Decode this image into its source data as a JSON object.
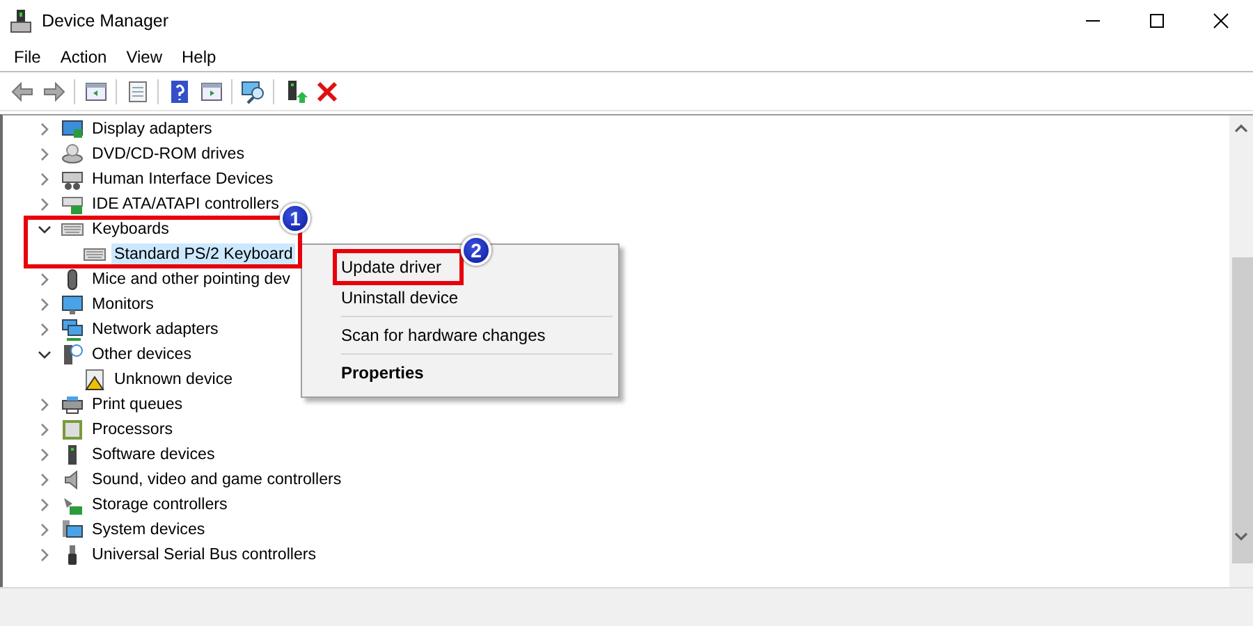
{
  "window": {
    "title": "Device Manager"
  },
  "menu": [
    "File",
    "Action",
    "View",
    "Help"
  ],
  "tree": [
    {
      "label": "Display adapters",
      "expanded": false
    },
    {
      "label": "DVD/CD-ROM drives",
      "expanded": false
    },
    {
      "label": "Human Interface Devices",
      "expanded": false
    },
    {
      "label": "IDE ATA/ATAPI controllers",
      "expanded": false
    },
    {
      "label": "Keyboards",
      "expanded": true,
      "children": [
        {
          "label": "Standard PS/2 Keyboard",
          "selected": true
        }
      ]
    },
    {
      "label": "Mice and other pointing dev",
      "expanded": false
    },
    {
      "label": "Monitors",
      "expanded": false
    },
    {
      "label": "Network adapters",
      "expanded": false
    },
    {
      "label": "Other devices",
      "expanded": true,
      "children": [
        {
          "label": "Unknown device",
          "selected": false
        }
      ]
    },
    {
      "label": "Print queues",
      "expanded": false
    },
    {
      "label": "Processors",
      "expanded": false
    },
    {
      "label": "Software devices",
      "expanded": false
    },
    {
      "label": "Sound, video and game controllers",
      "expanded": false
    },
    {
      "label": "Storage controllers",
      "expanded": false
    },
    {
      "label": "System devices",
      "expanded": false
    },
    {
      "label": "Universal Serial Bus controllers",
      "expanded": false
    }
  ],
  "context_menu": [
    {
      "kind": "item",
      "label": "Update driver",
      "default": false
    },
    {
      "kind": "item",
      "label": "Uninstall device",
      "default": false
    },
    {
      "kind": "separator"
    },
    {
      "kind": "item",
      "label": "Scan for hardware changes",
      "default": false
    },
    {
      "kind": "separator"
    },
    {
      "kind": "item",
      "label": "Properties",
      "default": true
    }
  ],
  "annotations": [
    {
      "number": "1"
    },
    {
      "number": "2"
    }
  ]
}
